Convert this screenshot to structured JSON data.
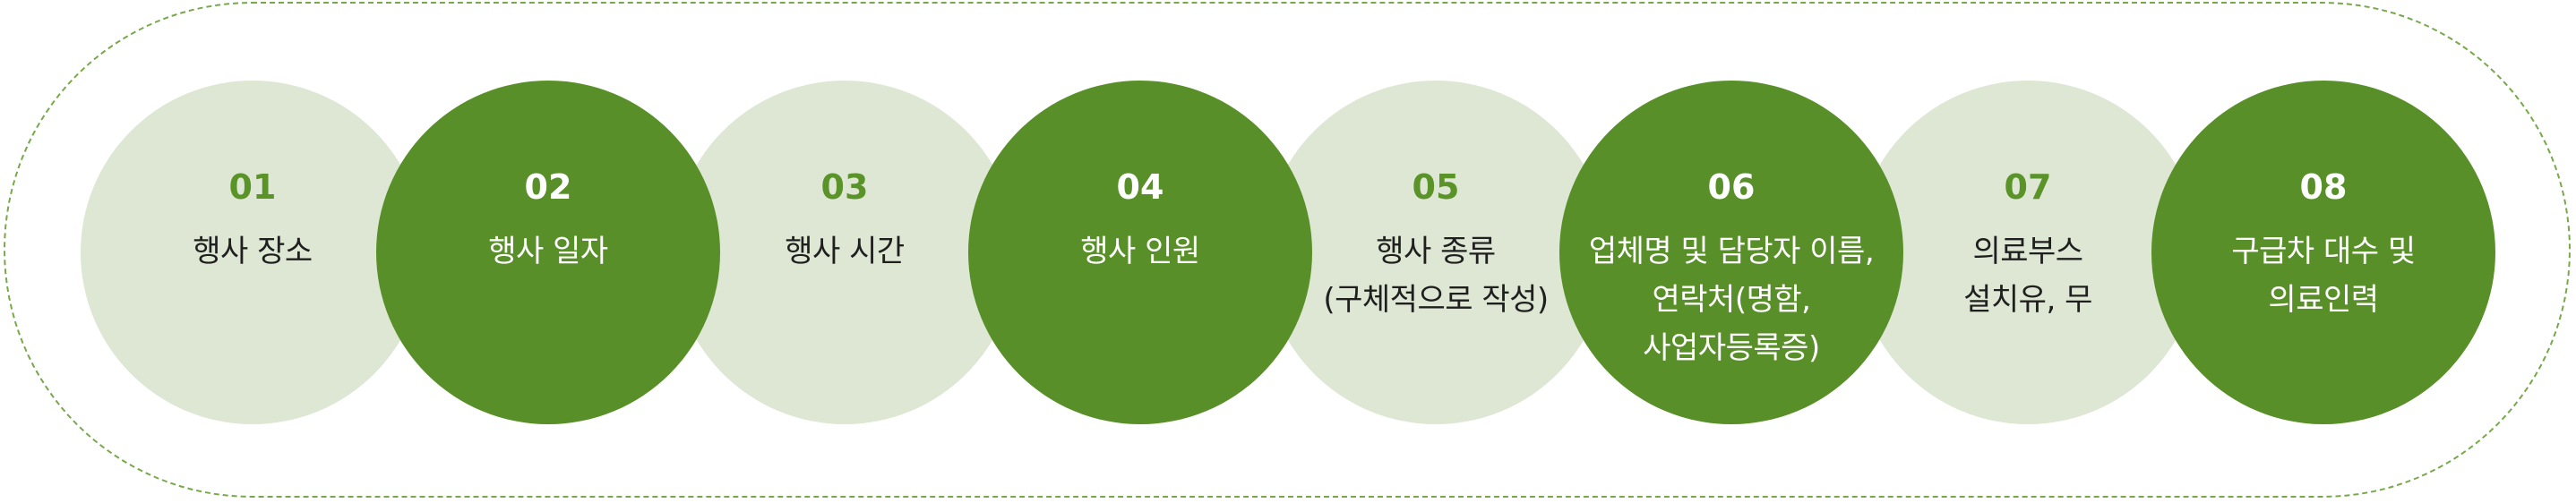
{
  "steps": [
    {
      "number": "01",
      "label": "행사 장소"
    },
    {
      "number": "02",
      "label": "행사 일자"
    },
    {
      "number": "03",
      "label": "행사 시간"
    },
    {
      "number": "04",
      "label": "행사 인원"
    },
    {
      "number": "05",
      "label": "행사 종류\n(구체적으로 작성)"
    },
    {
      "number": "06",
      "label": "업체명 및 담당자 이름,\n연락처(명함,\n사업자등록증)"
    },
    {
      "number": "07",
      "label": "의료부스\n설치유, 무"
    },
    {
      "number": "08",
      "label": "구급차 대수 및\n의료인력"
    }
  ],
  "colors": {
    "light_circle": "#dde7d3",
    "dark_circle": "#588f28",
    "accent_green": "#5a9328",
    "dashed_border": "#78a84a"
  }
}
